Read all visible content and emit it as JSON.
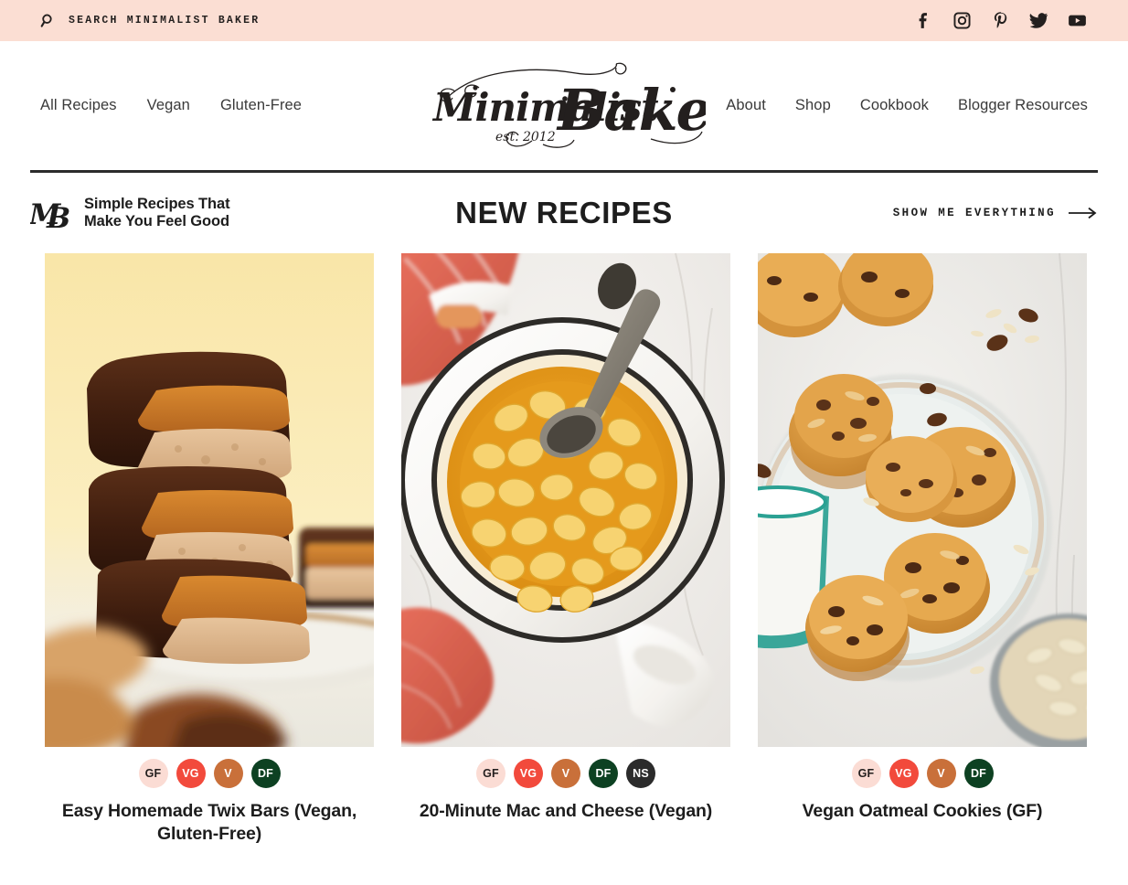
{
  "topbar": {
    "background": "#fbded3",
    "search": {
      "icon": "search-icon",
      "label": "SEARCH MINIMALIST BAKER",
      "placeholder": "SEARCH MINIMALIST BAKER"
    },
    "socials": [
      {
        "name": "facebook-icon",
        "label": "Facebook"
      },
      {
        "name": "instagram-icon",
        "label": "Instagram"
      },
      {
        "name": "pinterest-icon",
        "label": "Pinterest"
      },
      {
        "name": "twitter-icon",
        "label": "Twitter"
      },
      {
        "name": "youtube-icon",
        "label": "YouTube"
      }
    ]
  },
  "nav": {
    "left": [
      {
        "label": "All Recipes"
      },
      {
        "label": "Vegan"
      },
      {
        "label": "Gluten-Free"
      }
    ],
    "right": [
      {
        "label": "About"
      },
      {
        "label": "Shop"
      },
      {
        "label": "Cookbook"
      },
      {
        "label": "Blogger Resources"
      }
    ],
    "logo": {
      "name": "Minimalist Baker",
      "word_one": "Minimalist",
      "word_two": "Baker",
      "established": "est. 2012"
    }
  },
  "section": {
    "monogram": "MB",
    "tagline": "Simple Recipes That\nMake You Feel Good",
    "title": "NEW RECIPES",
    "show_all_label": "SHOW ME EVERYTHING",
    "arrow": "right-arrow-icon"
  },
  "badge_colors": {
    "GF": {
      "bg": "#fbdcd4",
      "fg": "#231f1e"
    },
    "VG": {
      "bg": "#f24a3c",
      "fg": "#ffffff"
    },
    "V": {
      "bg": "#c9703a",
      "fg": "#ffffff"
    },
    "DF": {
      "bg": "#0d4122",
      "fg": "#ffffff"
    },
    "NS": {
      "bg": "#2b2b2b",
      "fg": "#ffffff"
    }
  },
  "recipes": [
    {
      "title": "Easy Homemade Twix Bars (Vegan, Gluten-Free)",
      "image_alt": "Stack of chocolate-covered twix bars on a plate",
      "badges": [
        "GF",
        "VG",
        "V",
        "DF"
      ]
    },
    {
      "title": "20-Minute Mac and Cheese (Vegan)",
      "image_alt": "White dutch oven pot of shell macaroni and cheese with a spoon",
      "badges": [
        "GF",
        "VG",
        "V",
        "DF",
        "NS"
      ]
    },
    {
      "title": "Vegan Oatmeal Cookies (GF)",
      "image_alt": "Oatmeal raisin cookies on a white plate with a glass of milk",
      "badges": [
        "GF",
        "VG",
        "V",
        "DF"
      ]
    }
  ]
}
